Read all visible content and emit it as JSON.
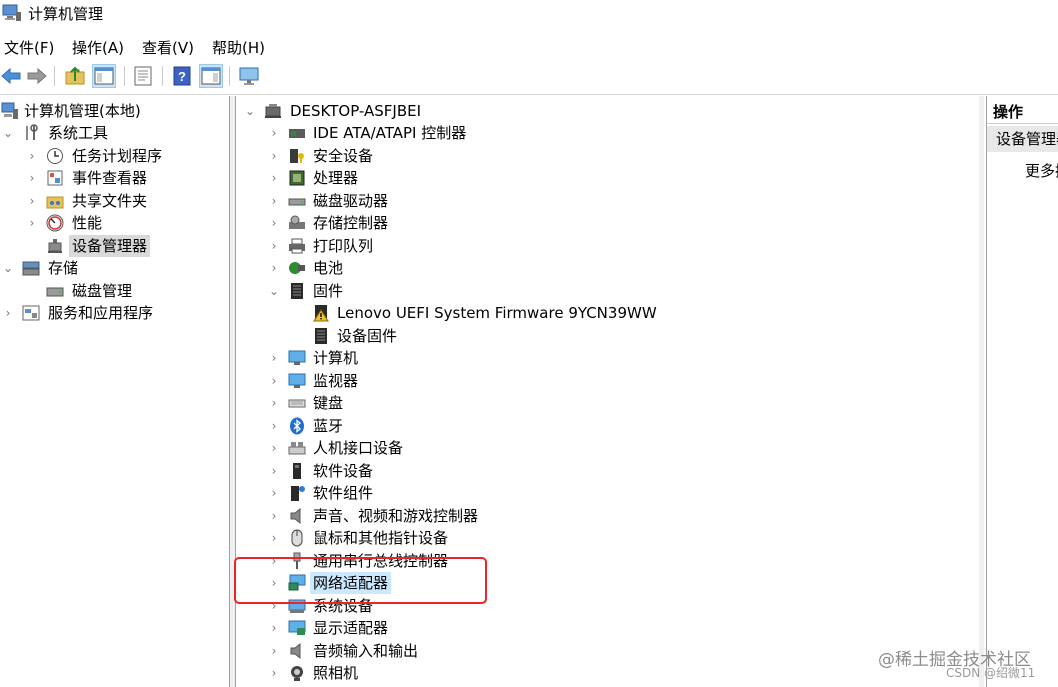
{
  "window": {
    "title": "计算机管理"
  },
  "menu": [
    "文件(F)",
    "操作(A)",
    "查看(V)",
    "帮助(H)"
  ],
  "toolbar": [
    "back-icon",
    "forward-icon",
    "up-folder-icon",
    "show-tree-icon",
    "properties-icon",
    "help-icon",
    "action-pane-icon",
    "monitor-icon"
  ],
  "left_tree": {
    "root": "计算机管理(本地)",
    "system_tools": "系统工具",
    "task_scheduler": "任务计划程序",
    "event_viewer": "事件查看器",
    "shared_folders": "共享文件夹",
    "performance": "性能",
    "device_manager": "设备管理器",
    "storage": "存储",
    "disk_management": "磁盘管理",
    "services": "服务和应用程序"
  },
  "device_tree": {
    "root": "DESKTOP-ASFJBEI",
    "items": [
      "IDE ATA/ATAPI 控制器",
      "安全设备",
      "处理器",
      "磁盘驱动器",
      "存储控制器",
      "打印队列",
      "电池",
      "固件",
      "Lenovo UEFI System Firmware 9YCN39WW",
      "设备固件",
      "计算机",
      "监视器",
      "键盘",
      "蓝牙",
      "人机接口设备",
      "软件设备",
      "软件组件",
      "声音、视频和游戏控制器",
      "鼠标和其他指针设备",
      "通用串行总线控制器",
      "网络适配器",
      "系统设备",
      "显示适配器",
      "音频输入和输出",
      "照相机"
    ]
  },
  "actions": {
    "header": "操作",
    "section": "设备管理器",
    "more": "更多操作"
  },
  "watermark": {
    "line1": "@稀土掘金技术社区",
    "line2": "CSDN @绍微11"
  }
}
